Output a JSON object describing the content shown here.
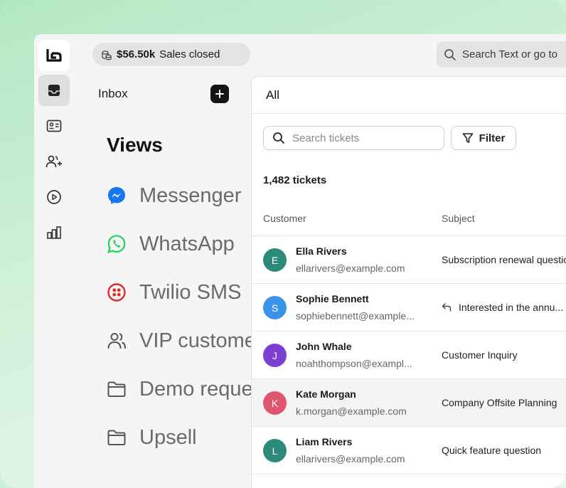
{
  "header": {
    "sales_amount": "$56.50k",
    "sales_label": "Sales closed",
    "search_placeholder": "Search Text or go to"
  },
  "sidebar": {
    "inbox_label": "Inbox",
    "views_title": "Views",
    "items": [
      {
        "label": "Messenger",
        "icon": "messenger-icon",
        "color": "#1877f2"
      },
      {
        "label": "WhatsApp",
        "icon": "whatsapp-icon",
        "color": "#25d366"
      },
      {
        "label": "Twilio SMS",
        "icon": "twilio-icon",
        "color": "#e0282f"
      },
      {
        "label": "VIP customers",
        "icon": "users-icon",
        "color": "#555555"
      },
      {
        "label": "Demo requests",
        "icon": "folder-icon",
        "color": "#555555"
      },
      {
        "label": "Upsell",
        "icon": "folder-icon",
        "color": "#555555"
      }
    ]
  },
  "tickets": {
    "tab": "All",
    "search_placeholder": "Search tickets",
    "filter_label": "Filter",
    "count": "1,482 tickets",
    "columns": [
      "Customer",
      "Subject"
    ],
    "rows": [
      {
        "initial": "E",
        "name": "Ella Rivers",
        "email": "ellarivers@example.com",
        "subject": "Subscription renewal question",
        "color": "#2b8a7a",
        "reply": false
      },
      {
        "initial": "S",
        "name": "Sophie Bennett",
        "email": "sophiebennett@example...",
        "subject": "Interested in the annu...",
        "color": "#3b94e8",
        "reply": true
      },
      {
        "initial": "J",
        "name": "John Whale",
        "email": "noahthompson@exampl...",
        "subject": "Customer Inquiry",
        "color": "#7b3fd1",
        "reply": false
      },
      {
        "initial": "K",
        "name": "Kate Morgan",
        "email": "k.morgan@example.com",
        "subject": "Company Offsite Planning",
        "color": "#e0566e",
        "reply": false
      },
      {
        "initial": "L",
        "name": "Liam Rivers",
        "email": "ellarivers@example.com",
        "subject": "Quick feature question",
        "color": "#2b8a7a",
        "reply": false
      }
    ]
  }
}
